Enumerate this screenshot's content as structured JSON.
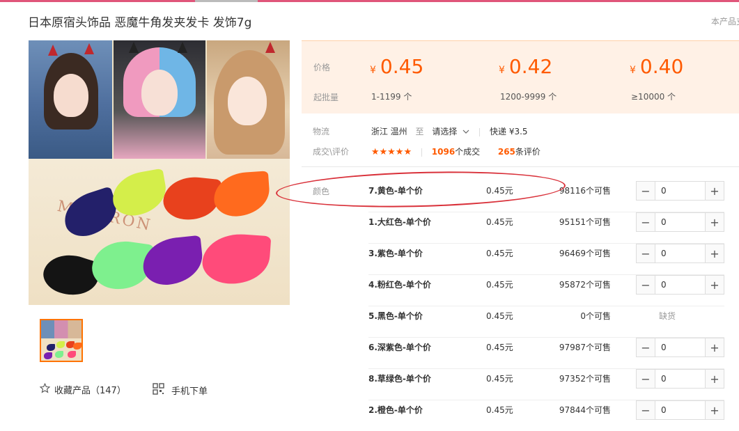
{
  "title": "日本原宿头饰品 恶魔牛角发夹发卡 发饰7g",
  "right_note": "本产品支",
  "gallery": {
    "product_text": "MAKIRON"
  },
  "actions": {
    "favorite_label": "收藏产品（147）",
    "mobile_order_label": "手机下单"
  },
  "pricing": {
    "price_label": "价格",
    "moq_label": "起批量",
    "currency": "¥",
    "tiers": [
      {
        "price": "0.45",
        "range": "1-1199 个"
      },
      {
        "price": "0.42",
        "range": "1200-9999 个"
      },
      {
        "price": "0.40",
        "range": "≥10000 个"
      }
    ]
  },
  "logistics": {
    "label": "物流",
    "origin": "浙江 温州",
    "to": "至",
    "destination": "请选择",
    "shipping": "快递 ¥3.5"
  },
  "reviews": {
    "label": "成交\\评价",
    "stars": "★★★★★",
    "deals_count": "1096",
    "deals_unit": "个成交",
    "reviews_count": "265",
    "reviews_unit": "条评价"
  },
  "sku": {
    "label": "颜色",
    "rows": [
      {
        "name": "7.黄色-单个价",
        "price": "0.45元",
        "stock": "98116个可售",
        "qty": "0",
        "available": true
      },
      {
        "name": "1.大红色-单个价",
        "price": "0.45元",
        "stock": "95151个可售",
        "qty": "0",
        "available": true
      },
      {
        "name": "3.紫色-单个价",
        "price": "0.45元",
        "stock": "96469个可售",
        "qty": "0",
        "available": true
      },
      {
        "name": "4.粉红色-单个价",
        "price": "0.45元",
        "stock": "95872个可售",
        "qty": "0",
        "available": true
      },
      {
        "name": "5.黑色-单个价",
        "price": "0.45元",
        "stock": "0个可售",
        "qty": "",
        "available": false,
        "status": "缺货"
      },
      {
        "name": "6.深紫色-单个价",
        "price": "0.45元",
        "stock": "97987个可售",
        "qty": "0",
        "available": true
      },
      {
        "name": "8.草绿色-单个价",
        "price": "0.45元",
        "stock": "97352个可售",
        "qty": "0",
        "available": true
      },
      {
        "name": "2.橙色-单个价",
        "price": "0.45元",
        "stock": "97844个可售",
        "qty": "0",
        "available": true
      }
    ]
  },
  "colors": {
    "accent": "#ff5a00",
    "annotation": "#d9313a",
    "price_bg": "#fff1e6"
  }
}
